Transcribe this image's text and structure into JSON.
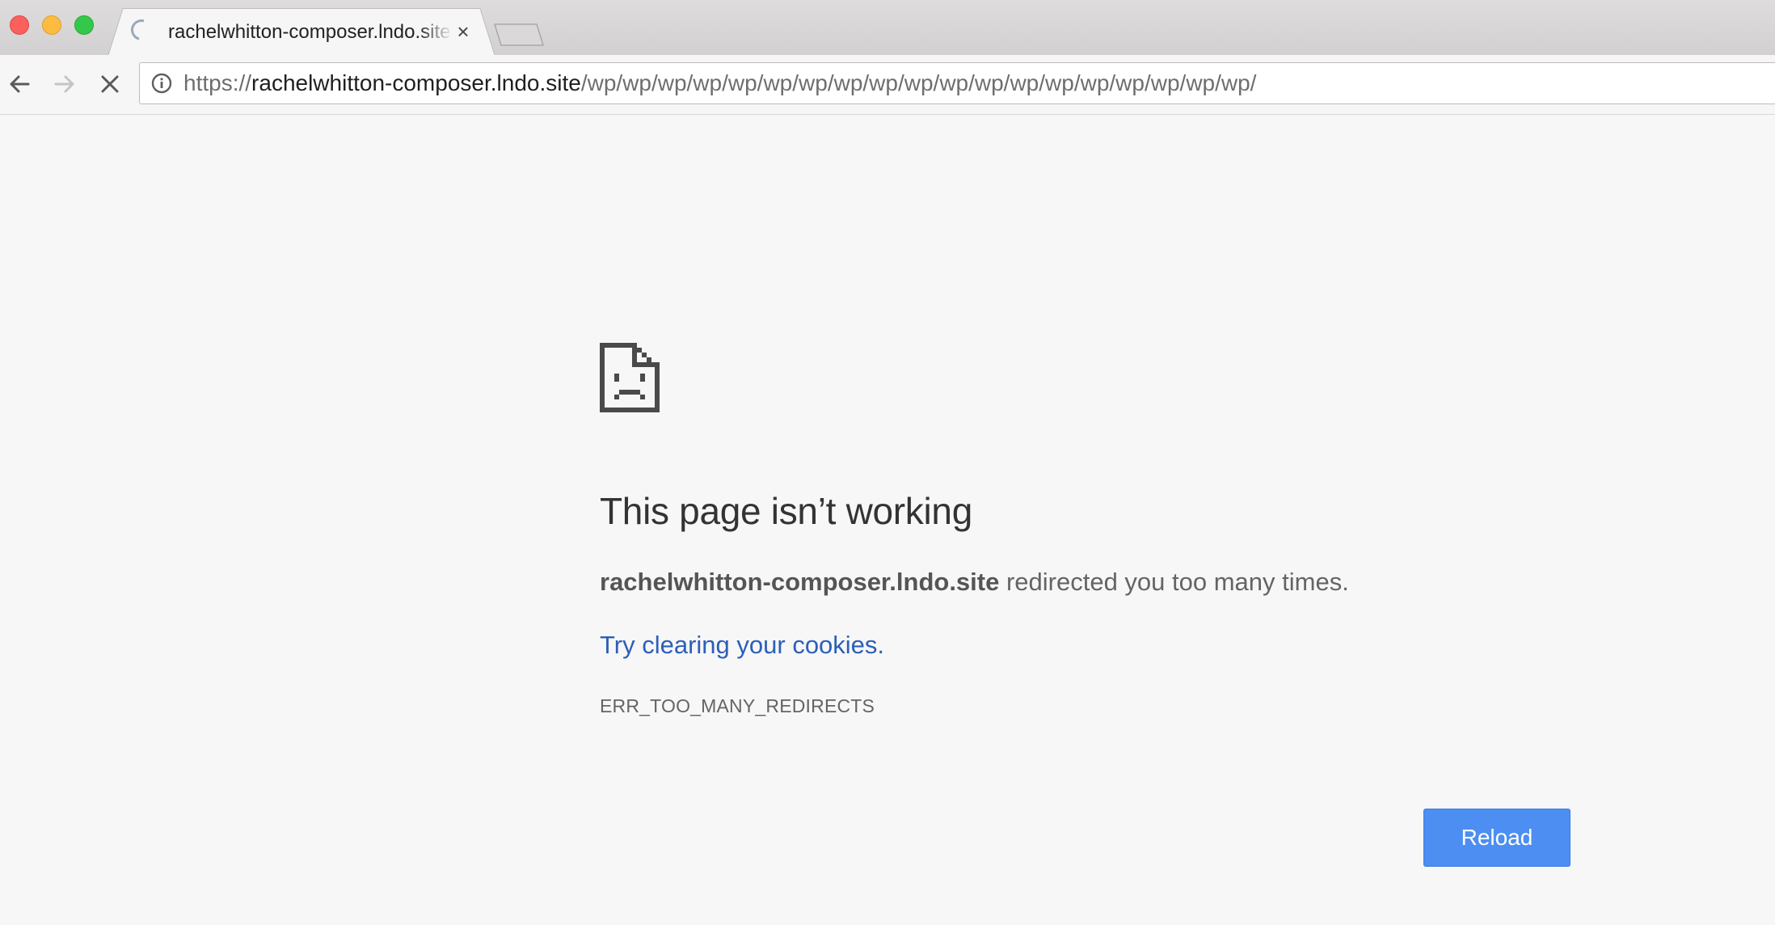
{
  "window": {
    "tab": {
      "title": "rachelwhitton-composer.lndo.site",
      "close_glyph": "×"
    }
  },
  "toolbar": {
    "icons": {
      "back": "back-arrow-icon",
      "forward": "forward-arrow-icon",
      "stop": "stop-loading-icon",
      "info": "site-info-icon"
    },
    "url": {
      "scheme": "https://",
      "host": "rachelwhitton-composer.lndo.site",
      "path": "/wp/wp/wp/wp/wp/wp/wp/wp/wp/wp/wp/wp/wp/wp/wp/wp/wp/wp/wp/"
    }
  },
  "error": {
    "icon": "sad-page-icon",
    "heading": "This page isn’t working",
    "domain": "rachelwhitton-composer.lndo.site",
    "message_rest": " redirected you too many times.",
    "suggestion_link": "Try clearing your cookies",
    "suggestion_period": ".",
    "code": "ERR_TOO_MANY_REDIRECTS",
    "reload_label": "Reload"
  },
  "colors": {
    "page_background": "#f7f7f7",
    "link": "#2b5fb9",
    "reload_button": "#4c8ef2",
    "traffic_close": "#fc605c",
    "traffic_minimize": "#fdbc40",
    "traffic_zoom": "#34c84a"
  }
}
